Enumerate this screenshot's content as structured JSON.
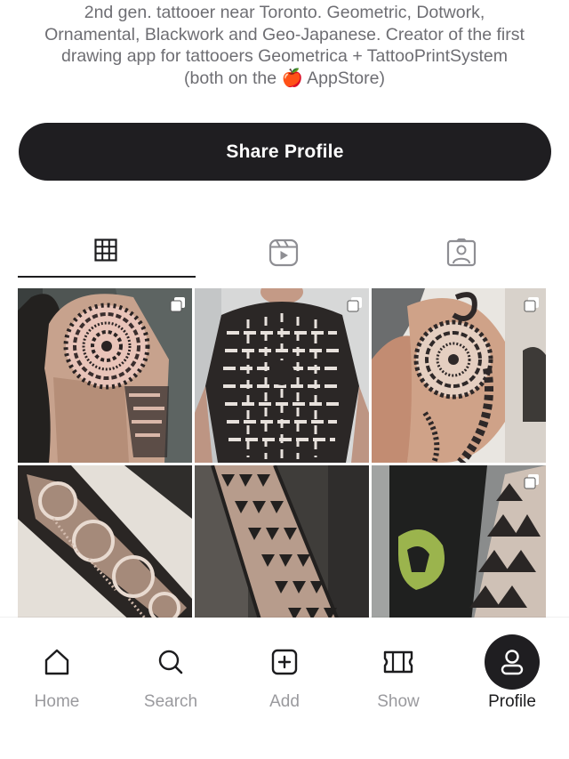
{
  "bio": {
    "lines": [
      "2nd gen. tattooer near Toronto.  Geometric, Dotwork,",
      "Ornamental, Blackwork and Geo-Japanese.  Creator of the first",
      "drawing app for tattooers Geometrica + TattooPrintSystem",
      "(both on the 🍎 AppStore)"
    ]
  },
  "share_button": {
    "label": "Share Profile"
  },
  "tabs": [
    {
      "name": "grid-tab",
      "icon": "grid-icon",
      "active": true
    },
    {
      "name": "reels-tab",
      "icon": "reels-icon",
      "active": false
    },
    {
      "name": "tagged-tab",
      "icon": "tagged-person-icon",
      "active": false
    }
  ],
  "posts": [
    {
      "subject": "geometric mandala chest and shoulder tattoo",
      "multiple": true
    },
    {
      "subject": "geometric maze full back tattoo",
      "multiple": true
    },
    {
      "subject": "ornamental mandala shoulder tattoo",
      "multiple": true
    },
    {
      "subject": "dotwork sleeve tattoo",
      "multiple": false
    },
    {
      "subject": "triangle geometric forearm tattoo",
      "multiple": false
    },
    {
      "subject": "triangle pattern sleeve tattoo",
      "multiple": true
    }
  ],
  "nav": {
    "items": [
      {
        "label": "Home",
        "icon": "home-icon",
        "active": false
      },
      {
        "label": "Search",
        "icon": "search-icon",
        "active": false
      },
      {
        "label": "Add",
        "icon": "add-icon",
        "active": false
      },
      {
        "label": "Show",
        "icon": "ticket-icon",
        "active": false
      },
      {
        "label": "Profile",
        "icon": "profile-icon",
        "active": true
      }
    ]
  },
  "colors": {
    "dark": "#1f1e21",
    "muted": "#9a9a9e",
    "bio_text": "#6e6e73",
    "background": "#ffffff"
  }
}
